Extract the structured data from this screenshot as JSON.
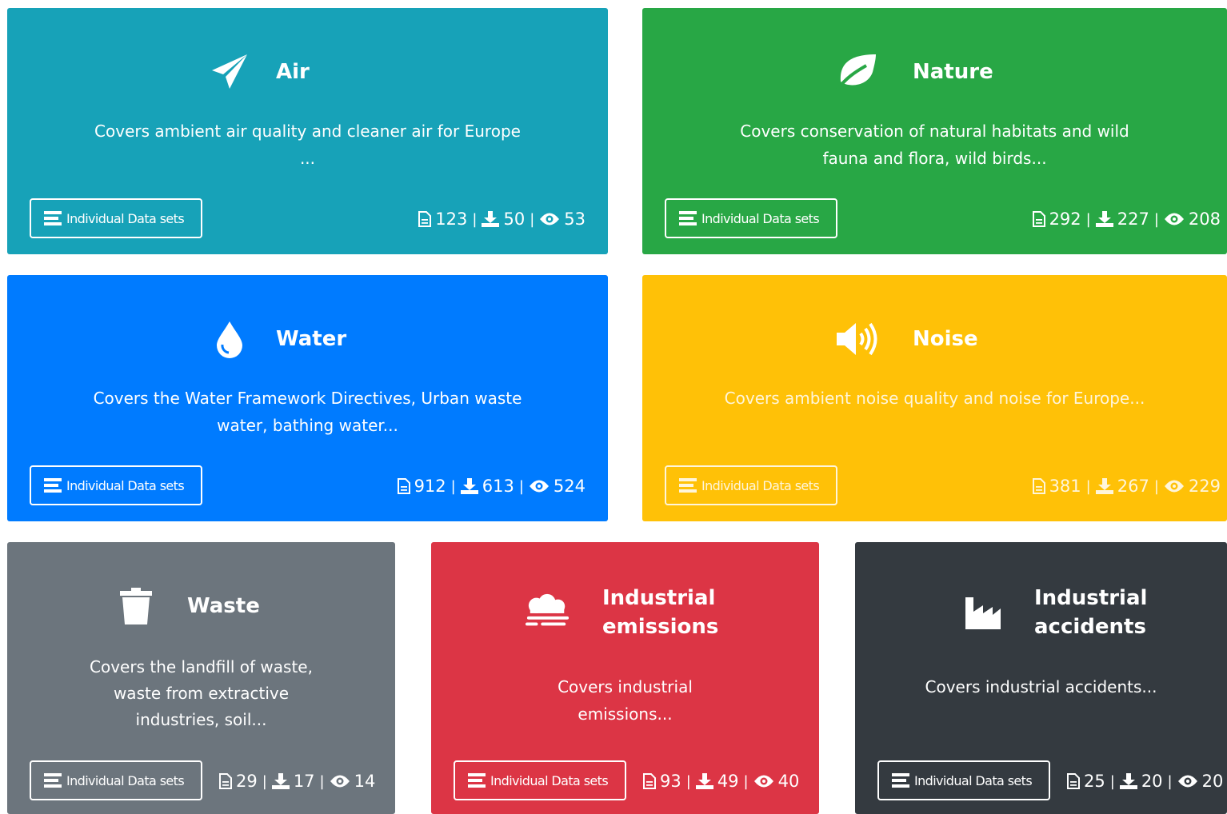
{
  "common": {
    "button_label": "Individual Data sets",
    "separator": "|"
  },
  "colors": {
    "air": "#17a2b8",
    "nature": "#28a745",
    "water": "#007bff",
    "noise": "#ffc107",
    "waste": "#6c757d",
    "industrial_emissions": "#dc3545",
    "industrial_accidents": "#343a40"
  },
  "cards": [
    {
      "key": "air",
      "icon": "paper-plane-icon",
      "title": "Air",
      "description": "Covers ambient air quality and cleaner air for Europe\n...",
      "documents": "123",
      "downloads": "50",
      "views": "53"
    },
    {
      "key": "nature",
      "icon": "leaf-icon",
      "title": "Nature",
      "description": "Covers conservation of natural habitats and wild fauna and flora, wild birds...",
      "documents": "292",
      "downloads": "227",
      "views": "208"
    },
    {
      "key": "water",
      "icon": "water-drop-icon",
      "title": "Water",
      "description": "Covers the Water Framework Directives, Urban waste water, bathing water...",
      "documents": "912",
      "downloads": "613",
      "views": "524"
    },
    {
      "key": "noise",
      "icon": "volume-icon",
      "title": "Noise",
      "description": "Covers ambient noise quality and noise for Europe...",
      "documents": "381",
      "downloads": "267",
      "views": "229"
    },
    {
      "key": "waste",
      "icon": "trash-icon",
      "title": "Waste",
      "description": "Covers the landfill of waste, waste from extractive industries, soil...",
      "documents": "29",
      "downloads": "17",
      "views": "14"
    },
    {
      "key": "industrial_emissions",
      "icon": "smog-icon",
      "title": "Industrial emissions",
      "description": "Covers industrial emissions...",
      "documents": "93",
      "downloads": "49",
      "views": "40"
    },
    {
      "key": "industrial_accidents",
      "icon": "factory-icon",
      "title": "Industrial accidents",
      "description": "Covers industrial accidents...",
      "documents": "25",
      "downloads": "20",
      "views": "20"
    }
  ]
}
